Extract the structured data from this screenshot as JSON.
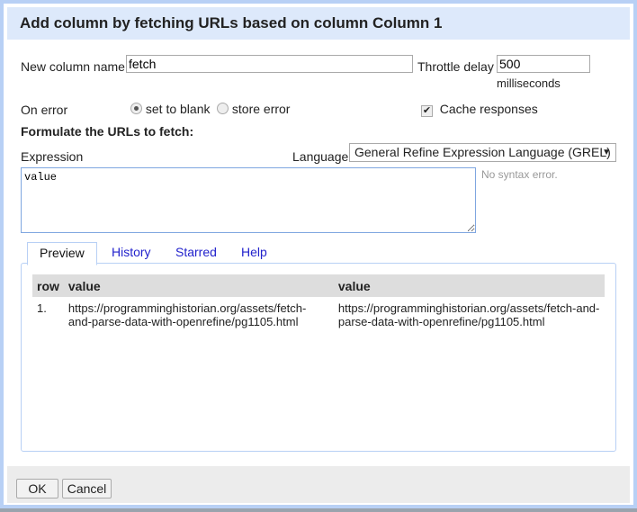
{
  "dialog": {
    "title": "Add column by fetching URLs based on column Column 1",
    "new_column_label": "New column name",
    "new_column_value": "fetch",
    "throttle_label": "Throttle delay",
    "throttle_value": "500",
    "throttle_unit": "milliseconds",
    "on_error_label": "On error",
    "on_error_options": [
      {
        "label": "set to blank",
        "selected": true
      },
      {
        "label": "store error",
        "selected": false
      }
    ],
    "cache_label": "Cache responses",
    "cache_checked": true,
    "formulate_heading": "Formulate the URLs to fetch:",
    "expression_label": "Expression",
    "language_label": "Language",
    "language_value": "General Refine Expression Language (GREL)",
    "expression_value": "value",
    "syntax_status": "No syntax error.",
    "tabs": [
      "Preview",
      "History",
      "Starred",
      "Help"
    ],
    "active_tab": "Preview",
    "preview": {
      "headers": [
        "row",
        "value",
        "value"
      ],
      "rows": [
        [
          "1.",
          "https://programminghistorian.org/assets/fetch-and-parse-data-with-openrefine/pg1105.html",
          "https://programminghistorian.org/assets/fetch-and-parse-data-with-openrefine/pg1105.html"
        ]
      ]
    },
    "ok_label": "OK",
    "cancel_label": "Cancel"
  }
}
